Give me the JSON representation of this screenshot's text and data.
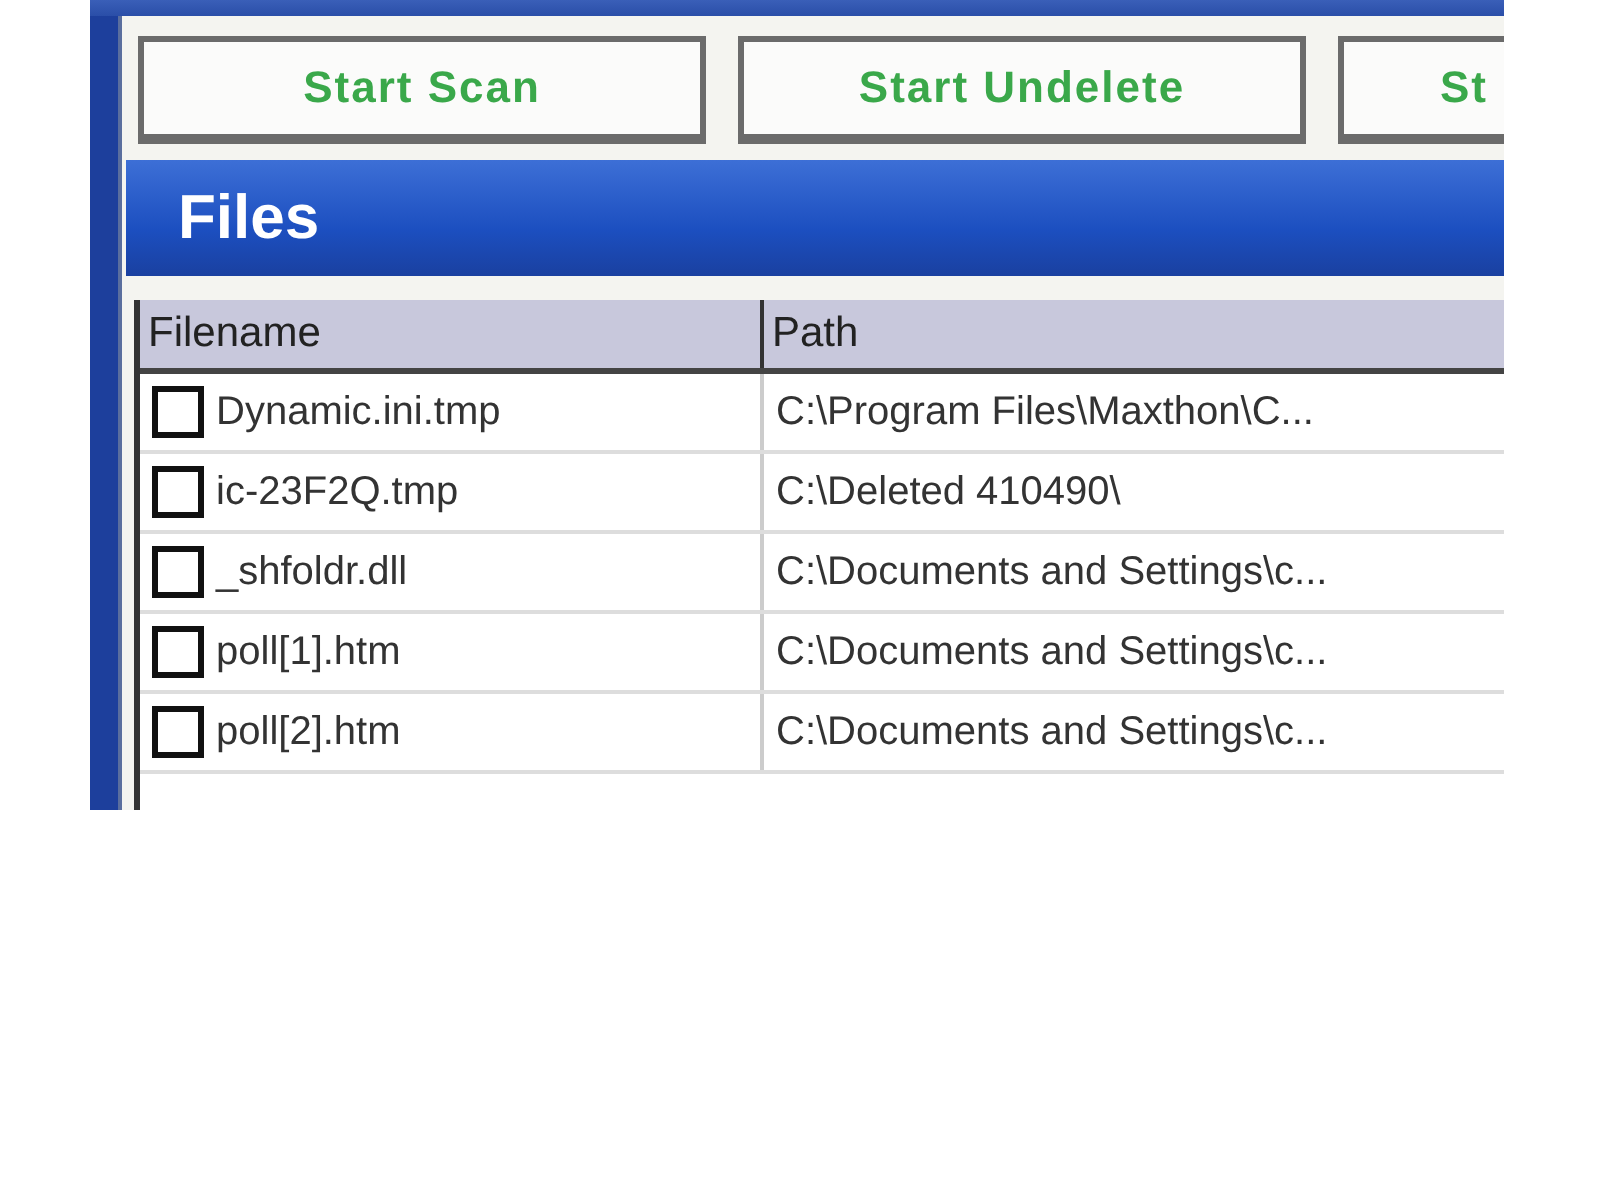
{
  "toolbar": {
    "buttons": [
      {
        "label": "Start Scan"
      },
      {
        "label": "Start Undelete"
      },
      {
        "label": "St"
      }
    ]
  },
  "panel": {
    "title": "Files"
  },
  "table": {
    "columns": [
      "Filename",
      "Path"
    ],
    "rows": [
      {
        "checked": false,
        "filename": "Dynamic.ini.tmp",
        "path": "C:\\Program Files\\Maxthon\\C..."
      },
      {
        "checked": false,
        "filename": "ic-23F2Q.tmp",
        "path": "C:\\Deleted 410490\\"
      },
      {
        "checked": false,
        "filename": "_shfoldr.dll",
        "path": "C:\\Documents and Settings\\c..."
      },
      {
        "checked": false,
        "filename": "poll[1].htm",
        "path": "C:\\Documents and Settings\\c..."
      },
      {
        "checked": false,
        "filename": "poll[2].htm",
        "path": "C:\\Documents and Settings\\c..."
      }
    ]
  }
}
